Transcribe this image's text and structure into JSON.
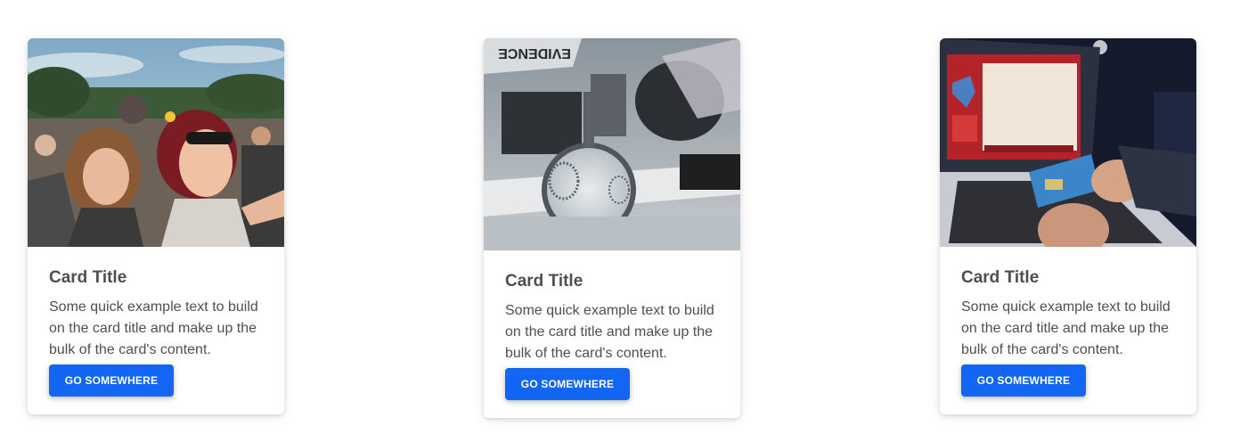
{
  "cards": [
    {
      "image_alt": "festival-crowd-photo",
      "title": "Card Title",
      "text": "Some quick example text to build on the card title and make up the bulk of the card's content.",
      "button_label": "GO SOMEWHERE"
    },
    {
      "image_alt": "fingerprint-evidence-photo",
      "image_label": "EVIDENCE",
      "title": "Card Title",
      "text": "Some quick example text to build on the card title and make up the bulk of the card's content.",
      "button_label": "GO SOMEWHERE"
    },
    {
      "image_alt": "laptop-credit-card-photo",
      "title": "Card Title",
      "text": "Some quick example text to build on the card title and make up the bulk of the card's content.",
      "button_label": "GO SOMEWHERE"
    }
  ],
  "colors": {
    "button": "#1266f1",
    "text": "#4f4f4f"
  }
}
